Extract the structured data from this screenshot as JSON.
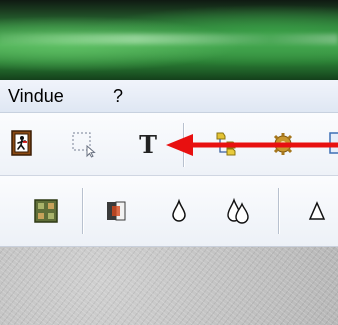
{
  "menubar": {
    "items": [
      {
        "label": "Vindue"
      },
      {
        "label": "?"
      }
    ]
  },
  "toolbar1": {
    "exit_tool": {
      "icon": "exit-door-icon"
    },
    "select_tool": {
      "icon": "dashed-selection-icon"
    },
    "text_tool": {
      "label": "T",
      "icon": "text-tool-icon"
    },
    "tree_tool": {
      "icon": "folder-tree-icon"
    },
    "gear_tool": {
      "icon": "gear-icon"
    },
    "annotation": {
      "color": "#e81010"
    }
  },
  "toolbar2": {
    "tools": [
      {
        "icon": "grid-pattern-icon"
      },
      {
        "icon": "split-color-icon"
      },
      {
        "icon": "drop-icon"
      },
      {
        "icon": "double-drop-icon"
      },
      {
        "icon": "triangle-icon"
      }
    ]
  },
  "colors": {
    "accent_arrow": "#e81010",
    "menubar_bg": "#e4ebf5",
    "titlebar_green": "#4fae57"
  }
}
